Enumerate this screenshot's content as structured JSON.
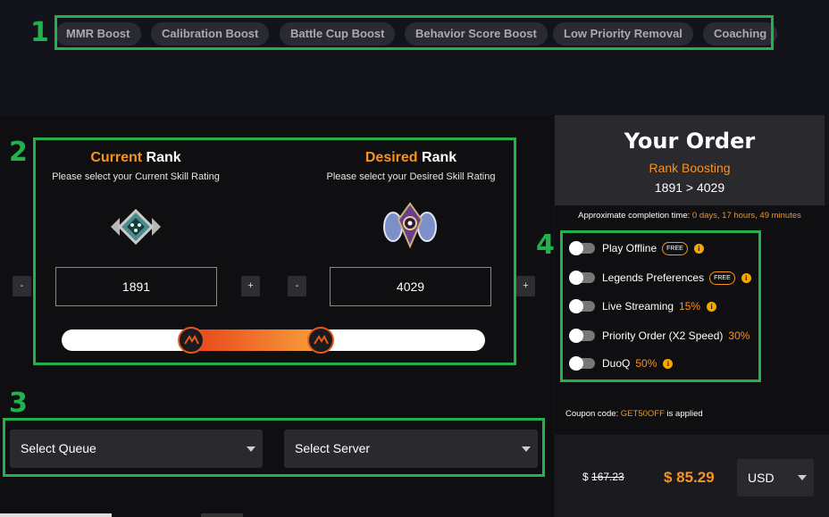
{
  "annotations": {
    "n1": "1",
    "n2": "2",
    "n3": "3",
    "n4": "4"
  },
  "nav": {
    "items": [
      "MMR Boost",
      "Calibration Boost",
      "Battle Cup Boost",
      "Behavior Score Boost",
      "Low Priority Removal",
      "Coaching"
    ]
  },
  "current_rank": {
    "title_accent": "Current",
    "title_rest": " Rank",
    "subtitle": "Please select your Current Skill Rating",
    "value": "1891",
    "minus_label": "-",
    "plus_label": "+"
  },
  "desired_rank": {
    "title_accent": "Desired",
    "title_rest": " Rank",
    "subtitle": "Please select your Desired Skill Rating",
    "value": "4029",
    "minus_label": "-",
    "plus_label": "+"
  },
  "selects": {
    "queue": "Select Queue",
    "server": "Select Server"
  },
  "order": {
    "title": "Your Order",
    "type": "Rank Boosting",
    "range": "1891 > 4029",
    "completion_label": "Approximate completion time: ",
    "completion_value": "0 days, 17 hours, 49 minutes"
  },
  "options": [
    {
      "label": "Play Offline",
      "badge": "FREE",
      "percent": ""
    },
    {
      "label": "Legends Preferences",
      "badge": "FREE",
      "percent": ""
    },
    {
      "label": "Live Streaming",
      "badge": "",
      "percent": "15%"
    },
    {
      "label": "Priority Order (X2 Speed)",
      "badge": "",
      "percent": "30%"
    },
    {
      "label": "DuoQ",
      "badge": "",
      "percent": "50%"
    }
  ],
  "info_glyph": "i",
  "coupon": {
    "prefix": "Coupon code: ",
    "code": "GET50OFF",
    "suffix": " is applied"
  },
  "price": {
    "currency_symbol": "$ ",
    "old_value": "167.23",
    "new_value": "$ 85.29",
    "currency": "USD"
  },
  "colors": {
    "accent": "#f7931e",
    "annotation": "#22b14c"
  }
}
